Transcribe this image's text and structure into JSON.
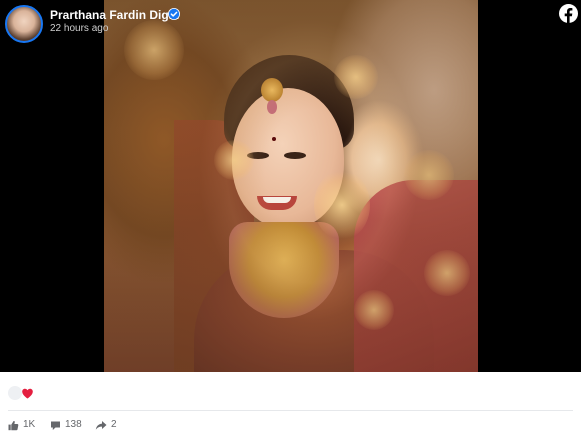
{
  "post": {
    "author": "Prarthana Fardin Dighi",
    "verified": true,
    "timestamp": "22 hours ago",
    "brand": "facebook-logo-icon",
    "media": {
      "alt": "image"
    }
  },
  "reactions": {
    "types": [
      "like-reaction-icon",
      "love-reaction-icon"
    ]
  },
  "stats": {
    "likes": "1K",
    "comments": "138",
    "shares": "2"
  },
  "colors": {
    "brand_blue": "#1877f2",
    "love_red": "#e41e3f",
    "muted_text": "#65676b",
    "viewer_bg": "#000000"
  }
}
